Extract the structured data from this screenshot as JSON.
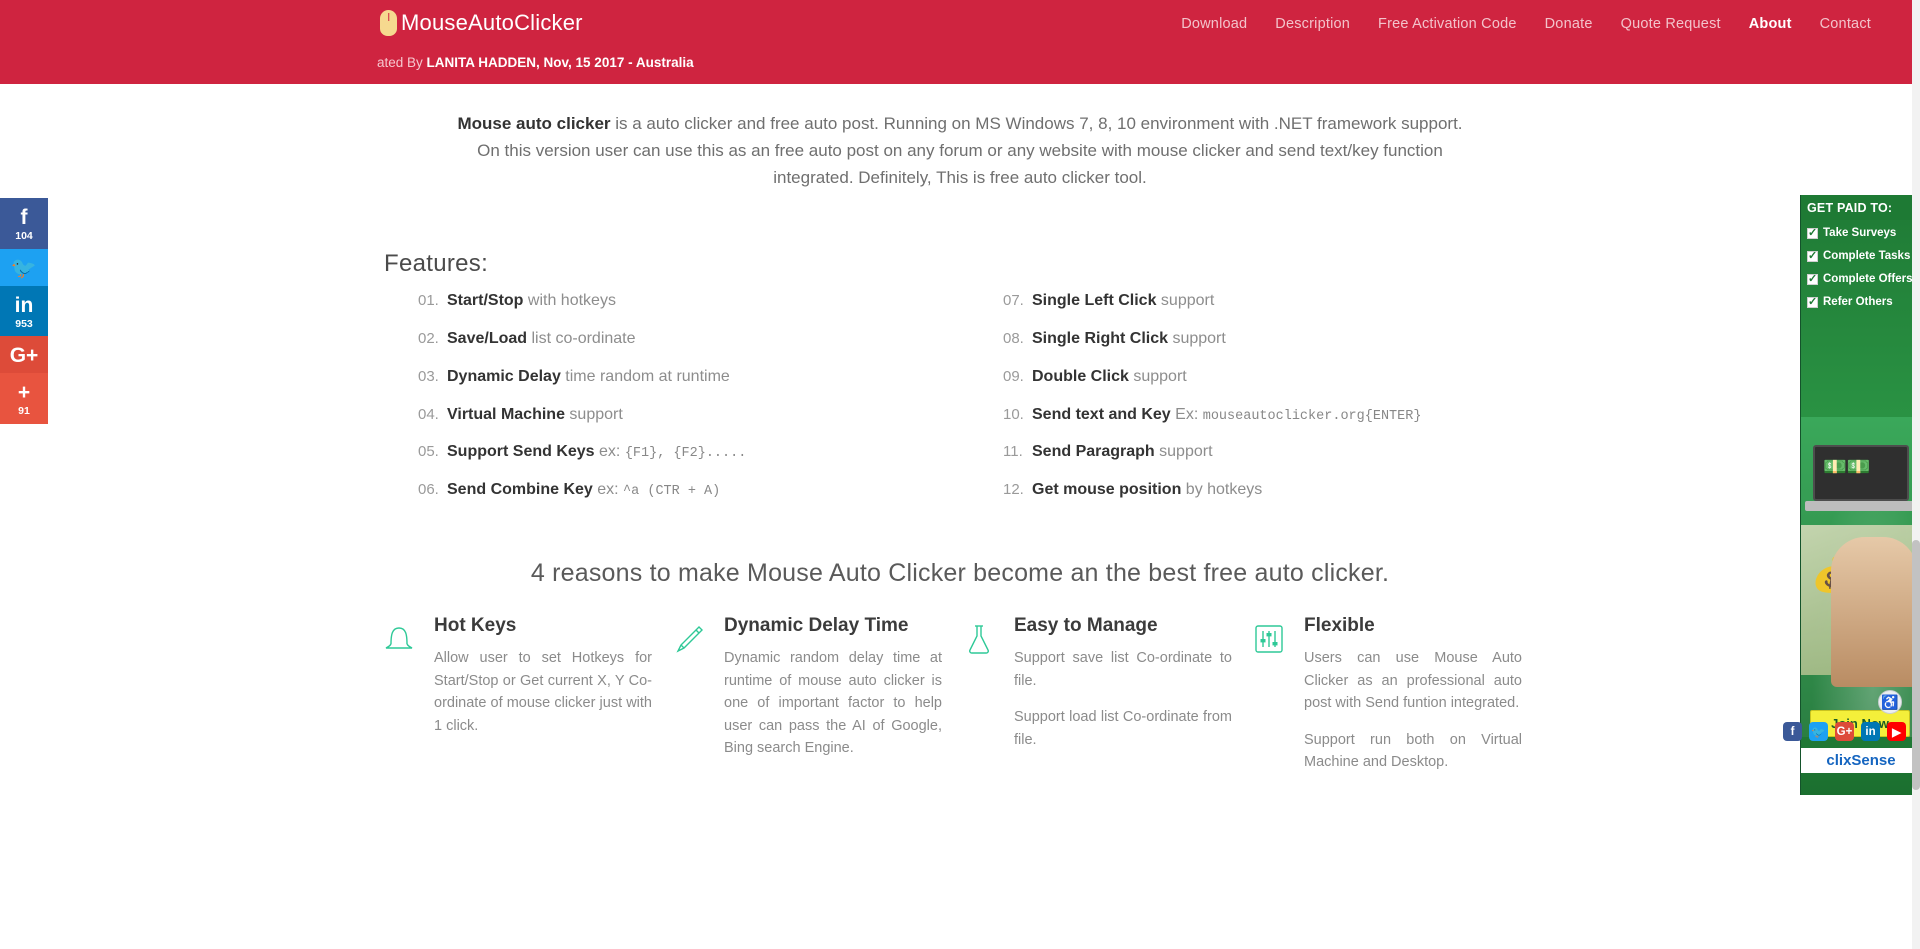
{
  "header": {
    "brand": "MouseAutoClicker",
    "brand_icon": "mouse-icon",
    "subtitle_prefix": "ated By",
    "subtitle_author": "LANITA HADDEN, Nov, 15 2017 - Australia",
    "background_color": "#cf2440",
    "nav": [
      {
        "label": "Download",
        "active": false
      },
      {
        "label": "Description",
        "active": false
      },
      {
        "label": "Free Activation Code",
        "active": false
      },
      {
        "label": "Donate",
        "active": false
      },
      {
        "label": "Quote Request",
        "active": false
      },
      {
        "label": "About",
        "active": true
      },
      {
        "label": "Contact",
        "active": false
      }
    ]
  },
  "social_rail": [
    {
      "name": "facebook",
      "glyph": "f",
      "count": "104",
      "color": "#3b5998"
    },
    {
      "name": "twitter",
      "glyph": "🐦",
      "count": "",
      "color": "#1da1f2"
    },
    {
      "name": "linkedin",
      "glyph": "in",
      "count": "953",
      "color": "#0077b5"
    },
    {
      "name": "google-plus",
      "glyph": "G+",
      "count": "",
      "color": "#dd4b39"
    },
    {
      "name": "share-more",
      "glyph": "+",
      "count": "91",
      "color": "#e8543f"
    }
  ],
  "intro": {
    "bold_lead": "Mouse auto clicker",
    "text": " is a auto clicker and free auto post. Running on MS Windows 7, 8, 10 environment with .NET framework support. On this version user can use this as an free auto post on any forum or any website with mouse clicker and send text/key function integrated. Definitely, This is free auto clicker tool."
  },
  "features": {
    "heading": "Features:",
    "left": [
      {
        "num": "01.",
        "name": "Start/Stop",
        "rest": " with hotkeys",
        "mono": ""
      },
      {
        "num": "02.",
        "name": "Save/Load",
        "rest": " list co-ordinate",
        "mono": ""
      },
      {
        "num": "03.",
        "name": "Dynamic Delay",
        "rest": " time random at runtime",
        "mono": ""
      },
      {
        "num": "04.",
        "name": "Virtual Machine",
        "rest": " support",
        "mono": ""
      },
      {
        "num": "05.",
        "name": "Support Send Keys",
        "rest": " ex: ",
        "mono": "{F1}, {F2}....."
      },
      {
        "num": "06.",
        "name": "Send Combine Key",
        "rest": " ex: ",
        "mono": "^a (CTR + A)"
      }
    ],
    "right": [
      {
        "num": "07.",
        "name": "Single Left Click",
        "rest": " support",
        "mono": ""
      },
      {
        "num": "08.",
        "name": "Single Right Click",
        "rest": " support",
        "mono": ""
      },
      {
        "num": "09.",
        "name": "Double Click",
        "rest": " support",
        "mono": ""
      },
      {
        "num": "10.",
        "name": "Send text and Key",
        "rest": " Ex: ",
        "mono": "mouseautoclicker.org{ENTER}"
      },
      {
        "num": "11.",
        "name": "Send Paragraph",
        "rest": " support",
        "mono": ""
      },
      {
        "num": "12.",
        "name": "Get mouse position",
        "rest": " by hotkeys",
        "mono": ""
      }
    ]
  },
  "reasons": {
    "title": "4 reasons to make Mouse Auto Clicker become an the best free auto clicker.",
    "icon_color": "#2ec997",
    "cards": [
      {
        "icon": "bell-icon",
        "title": "Hot Keys",
        "paragraphs": [
          "Allow user to set Hotkeys for Start/Stop or Get current X, Y Co-ordinate of mouse clicker just with 1 click."
        ]
      },
      {
        "icon": "pencil-icon",
        "title": "Dynamic Delay Time",
        "paragraphs": [
          "Dynamic random delay time at runtime of mouse auto clicker is one of important factor to help user can pass the AI of Google, Bing search Engine."
        ]
      },
      {
        "icon": "flask-icon",
        "title": "Easy to Manage",
        "paragraphs": [
          "Support save list Co-ordinate to file.",
          "Support load list Co-ordinate from file."
        ]
      },
      {
        "icon": "sliders-icon",
        "title": "Flexible",
        "paragraphs": [
          "Users can use Mouse Auto Clicker as an professional auto post with Send funtion integrated.",
          "Support run both on Virtual Machine and Desktop."
        ]
      }
    ]
  },
  "ad": {
    "headline": "GET PAID TO:",
    "items": [
      "Take Surveys",
      "Complete Tasks",
      "Complete Offers",
      "Refer Others"
    ],
    "cta": "Join Now",
    "brand": "clixSense"
  },
  "share_bar": [
    {
      "name": "facebook",
      "glyph": "f",
      "color": "#3b5998"
    },
    {
      "name": "twitter",
      "glyph": "🐦",
      "color": "#1da1f2"
    },
    {
      "name": "google-plus",
      "glyph": "G+",
      "color": "#dd4b39"
    },
    {
      "name": "linkedin",
      "glyph": "in",
      "color": "#0077b5"
    },
    {
      "name": "youtube",
      "glyph": "▶",
      "color": "#ff0000"
    }
  ],
  "accessibility": {
    "glyph": "♿"
  }
}
